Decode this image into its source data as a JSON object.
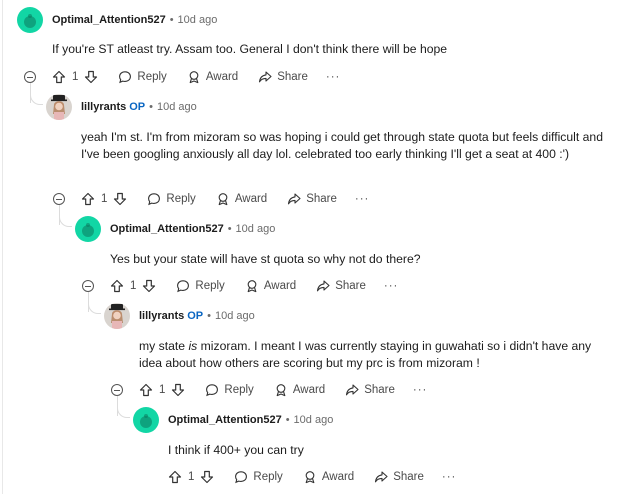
{
  "comments": [
    {
      "author": "Optimal_Attention527",
      "op": "",
      "age": "10d ago",
      "text": "If you're ST atleast try. Assam too. General I don't think there will be hope",
      "votes": "1",
      "reply": "Reply",
      "award": "Award",
      "share": "Share",
      "more": "···"
    },
    {
      "author": "lillyrants",
      "op": "OP",
      "age": "10d ago",
      "text": "yeah I'm st. I'm from mizoram so was hoping i could get through state quota but feels difficult and I've been googling anxiously all day lol. celebrated too early thinking I'll get a seat at 400 :')",
      "votes": "1",
      "reply": "Reply",
      "award": "Award",
      "share": "Share",
      "more": "···"
    },
    {
      "author": "Optimal_Attention527",
      "op": "",
      "age": "10d ago",
      "text": "Yes but your state will have st quota so why not do there?",
      "votes": "1",
      "reply": "Reply",
      "award": "Award",
      "share": "Share",
      "more": "···"
    },
    {
      "author": "lillyrants",
      "op": "OP",
      "age": "10d ago",
      "text_before": "my state ",
      "text_em": "is",
      "text_after": " mizoram. I meant I was currently staying in guwahati so i didn't have any idea about how others are scoring but my prc is from mizoram !",
      "votes": "1",
      "reply": "Reply",
      "award": "Award",
      "share": "Share",
      "more": "···"
    },
    {
      "author": "Optimal_Attention527",
      "op": "",
      "age": "10d ago",
      "text": "I think if 400+ you can try",
      "votes": "1",
      "reply": "Reply",
      "award": "Award",
      "share": "Share",
      "more": "···"
    }
  ],
  "icons": {
    "upvote": "arrow-up-icon",
    "downvote": "arrow-down-icon",
    "reply": "speech-bubble-icon",
    "award": "award-ribbon-icon",
    "share": "share-arrow-icon",
    "collapse": "minus-circle-icon"
  },
  "colors": {
    "snoo_avatar": "#12d6a5",
    "op_badge": "#0a66c2",
    "meta_gray": "#6b6b6b",
    "thread_line": "#dcdcdc"
  }
}
